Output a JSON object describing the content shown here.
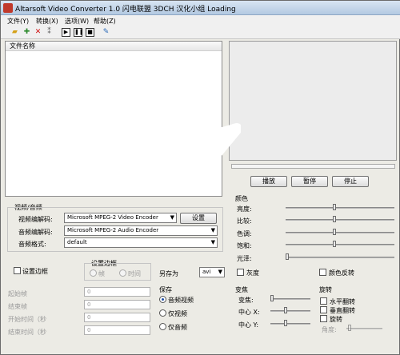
{
  "window": {
    "title": "Altarsoft Video Converter 1.0 闪电联盟 3DCH 汉化小组 Loading"
  },
  "menu": [
    "文件(Y)",
    "转换(X)",
    "选项(W)",
    "帮助(Z)"
  ],
  "toolbar": [
    "open-folder-icon",
    "add-icon",
    "delete-icon",
    "info-icon",
    "play-icon",
    "pause-icon",
    "stop-icon",
    "settings-icon"
  ],
  "file_list": {
    "header": "文件名称"
  },
  "player": {
    "play": "播放",
    "pause": "暂停",
    "stop": "停止"
  },
  "video_audio": {
    "group_title": "视频/音频",
    "video_codec_label": "视频编解码:",
    "video_codec_value": "Microsoft MPEG-2 Video Encoder",
    "settings_button": "设置",
    "audio_codec_label": "音频编解码:",
    "audio_codec_value": "Microsoft MPEG-2 Audio Encoder",
    "audio_format_label": "音频格式:",
    "audio_format_value": "default"
  },
  "border": {
    "set_border_check": "设置边框",
    "set_border_group": "设置边框",
    "frame_radio": "帧",
    "time_radio": "时间",
    "start_frame": "起始帧",
    "end_frame": "结束帧",
    "start_time": "开始时间（秒",
    "end_time": "结束时间（秒",
    "start_frame_value": "0",
    "end_frame_value": "0",
    "start_time_value": "0",
    "end_time_value": "0"
  },
  "save_as": {
    "label": "另存为",
    "value": "avi"
  },
  "save": {
    "title": "保存",
    "audio_video": "音频视频",
    "video_only": "仅视频",
    "audio_only": "仅音频"
  },
  "color": {
    "title": "颜色",
    "brightness": "亮度:",
    "contrast": "比较:",
    "hue": "色调:",
    "saturation": "饱和:",
    "gamma": "光泽:",
    "grayscale": "灰度",
    "invert": "颜色反转"
  },
  "focus": {
    "title": "变焦",
    "zoom": "变焦:",
    "center_x": "中心 X:",
    "center_y": "中心 Y:"
  },
  "rotate": {
    "title": "旋转",
    "flip_h": "水平翻转",
    "flip_v": "垂直翻转",
    "rotate": "旋转",
    "angle": "角度:"
  }
}
